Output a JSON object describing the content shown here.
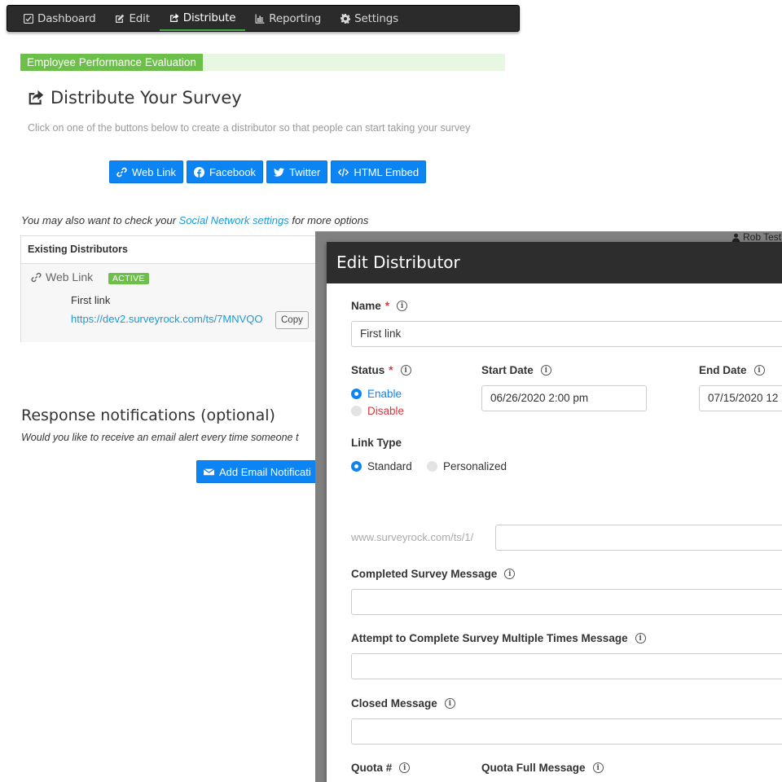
{
  "nav": {
    "items": [
      {
        "label": "Dashboard",
        "icon": "dashboard-icon"
      },
      {
        "label": "Edit",
        "icon": "edit-icon"
      },
      {
        "label": "Distribute",
        "icon": "share-icon"
      },
      {
        "label": "Reporting",
        "icon": "bar-chart-icon"
      },
      {
        "label": "Settings",
        "icon": "gear-icon"
      }
    ],
    "active": "Distribute"
  },
  "survey": {
    "title": "Employee Performance Evaluation"
  },
  "distribute": {
    "heading": "Distribute Your Survey",
    "intro": "Click on one of the buttons below to create a distributor so that people can start taking your survey",
    "buttons": [
      {
        "label": "Web Link",
        "icon": "link-icon"
      },
      {
        "label": "Facebook",
        "icon": "facebook-icon"
      },
      {
        "label": "Twitter",
        "icon": "twitter-icon"
      },
      {
        "label": "HTML Embed",
        "icon": "code-icon"
      }
    ],
    "also_prefix": "You may also want to check your ",
    "also_link": "Social Network settings",
    "also_suffix": " for more options"
  },
  "existing": {
    "header": "Existing Distributors",
    "type_label": "Web Link",
    "status_badge": "ACTIVE",
    "name": "First link",
    "url": "https://dev2.surveyrock.com/ts/7MNVQO",
    "copy_label": "Copy"
  },
  "responses": {
    "title": "Response notifications (optional)",
    "subtitle": "Would you like to receive an email alert every time someone t",
    "add_button": "Add Email Notificati"
  },
  "user": {
    "label": "Rob Test"
  },
  "modal": {
    "title": "Edit Distributor",
    "name_label": "Name",
    "name_value": "First link",
    "status_label": "Status",
    "status_options": [
      "Enable",
      "Disable"
    ],
    "status_selected": "Enable",
    "start_label": "Start Date",
    "start_value": "06/26/2020 2:00 pm",
    "end_label": "End Date",
    "end_value": "07/15/2020 12",
    "link_type_label": "Link Type",
    "link_type_options": [
      "Standard",
      "Personalized"
    ],
    "link_type_selected": "Standard",
    "url_prefix": "www.surveyrock.com/ts/1/",
    "completed_label": "Completed Survey Message",
    "attempt_label": "Attempt to Complete Survey Multiple Times Message",
    "closed_label": "Closed Message",
    "quota_label": "Quota #",
    "quota_full_label": "Quota Full Message",
    "required_mark": "*",
    "info_glyph": "i"
  },
  "colors": {
    "accent": "#0d84f4",
    "brand_green": "#6cc04a",
    "link": "#1a9bd8",
    "danger": "#d9363e"
  }
}
